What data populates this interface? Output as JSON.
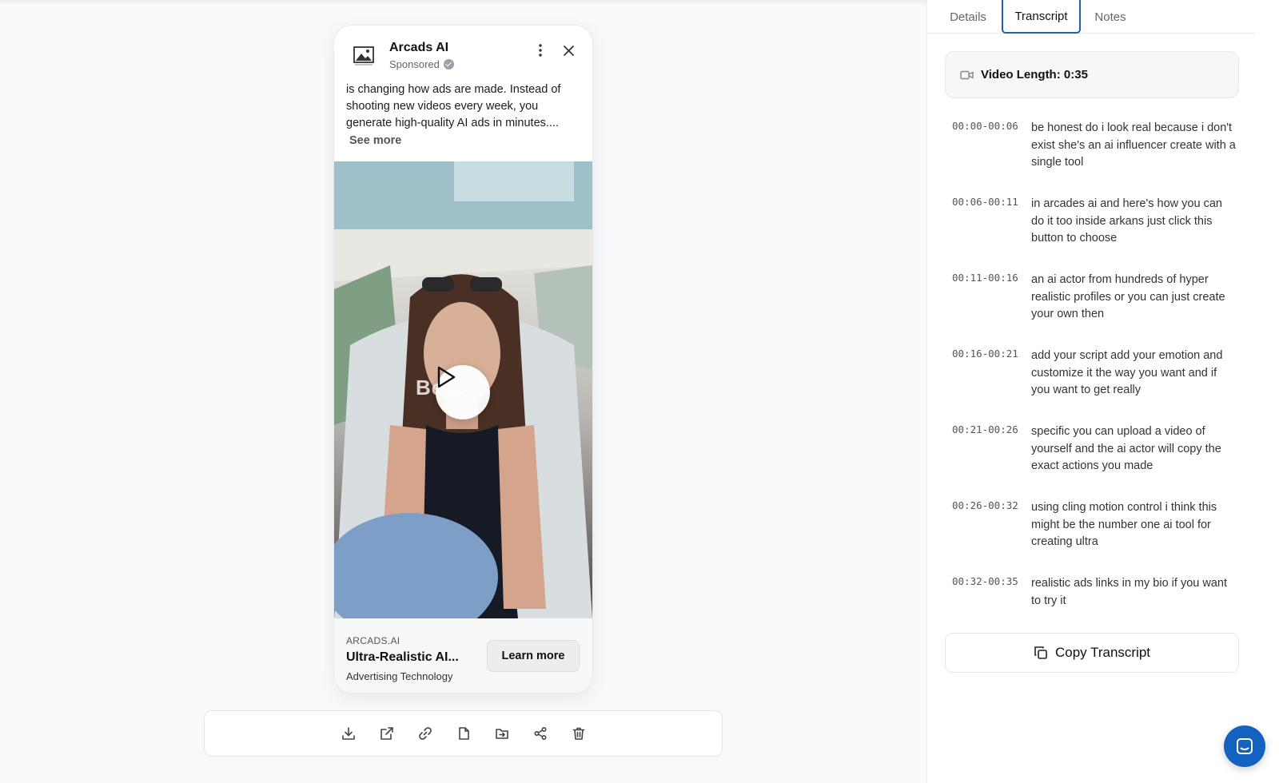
{
  "ad": {
    "brand": "Arcads AI",
    "sponsored": "Sponsored",
    "body": "is changing how ads are made. Instead of shooting new videos every week, you generate high-quality AI ads in minutes....",
    "see_more": "See more",
    "video_caption": "Be…",
    "domain": "ARCADS.AI",
    "title": "Ultra-Realistic AI...",
    "category": "Advertising Technology",
    "cta": "Learn more"
  },
  "toolbar": {
    "icons": [
      "download-icon",
      "external-link-icon",
      "link-icon",
      "file-icon",
      "folder-move-icon",
      "share-icon",
      "trash-icon"
    ]
  },
  "tabs": {
    "details": "Details",
    "transcript": "Transcript",
    "notes": "Notes",
    "active": "Transcript"
  },
  "transcript": {
    "video_length": "Video Length: 0:35",
    "segments": [
      {
        "time": "00:00-00:06",
        "text": "be honest do i look real because i don't exist she's an ai influencer create with a single tool"
      },
      {
        "time": "00:06-00:11",
        "text": "in arcades ai and here's how you can do it too inside arkans just click this button to choose"
      },
      {
        "time": "00:11-00:16",
        "text": "an ai actor from hundreds of hyper realistic profiles or you can just create your own then"
      },
      {
        "time": "00:16-00:21",
        "text": "add your script add your emotion and customize it the way you want and if you want to get really"
      },
      {
        "time": "00:21-00:26",
        "text": "specific you can upload a video of yourself and the ai actor will copy the exact actions you made"
      },
      {
        "time": "00:26-00:32",
        "text": "using cling motion control i think this might be the number one ai tool for creating ultra"
      },
      {
        "time": "00:32-00:35",
        "text": "realistic ads links in my bio if you want to try it"
      }
    ],
    "copy_label": "Copy Transcript"
  },
  "colors": {
    "accent": "#1d5fb0",
    "chat_button": "#1462bf"
  }
}
